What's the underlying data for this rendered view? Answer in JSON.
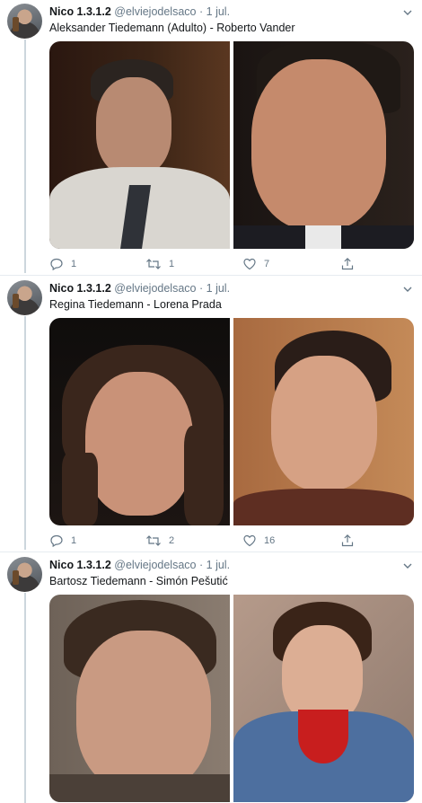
{
  "tweets": [
    {
      "name": "Nico 1.3.1.2",
      "handle": "@elviejodelsaco",
      "dot": "·",
      "time": "1 jul.",
      "text": "Aleksander Tiedemann (Adulto) - Roberto Vander",
      "replies": "1",
      "retweets": "1",
      "likes": "7"
    },
    {
      "name": "Nico 1.3.1.2",
      "handle": "@elviejodelsaco",
      "dot": "·",
      "time": "1 jul.",
      "text": "Regina Tiedemann - Lorena Prada",
      "replies": "1",
      "retweets": "2",
      "likes": "16"
    },
    {
      "name": "Nico 1.3.1.2",
      "handle": "@elviejodelsaco",
      "dot": "·",
      "time": "1 jul.",
      "text": "Bartosz Tiedemann - Simón Pešutić"
    }
  ],
  "icons": {
    "reply": "reply-icon",
    "retweet": "retweet-icon",
    "like": "heart-icon",
    "share": "share-icon",
    "more": "chevron-down-icon"
  },
  "colors": {
    "text_primary": "#14171a",
    "text_secondary": "#657786",
    "divider": "#e6ecf0",
    "thread_line": "#ccd6dd"
  }
}
